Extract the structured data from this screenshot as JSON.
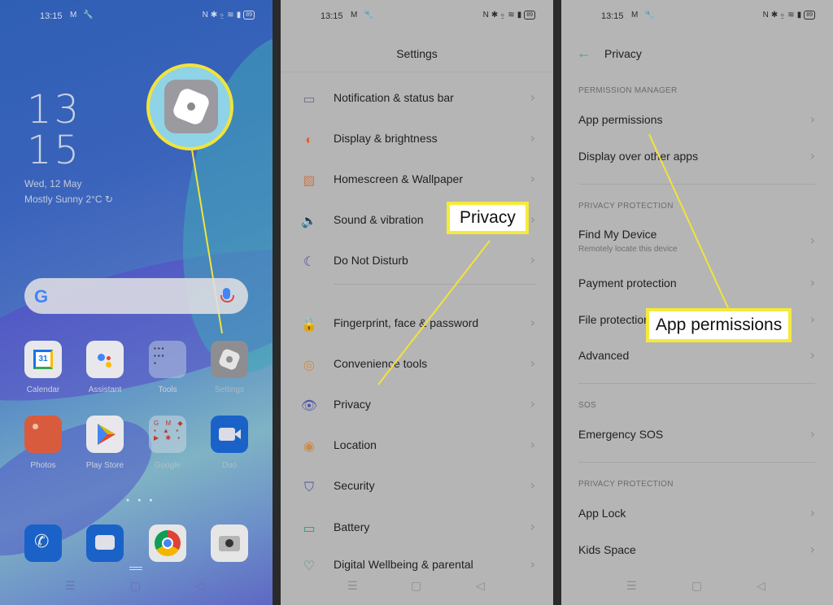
{
  "status_bar": {
    "time": "13:15",
    "left_icons": [
      "gmail-m-icon",
      "wrench-icon"
    ],
    "right_icons": [
      "nfc-icon",
      "bluetooth-icon",
      "vibrate-icon",
      "wifi-icon",
      "signal-icon"
    ],
    "battery": "89"
  },
  "home": {
    "clock_hour": "13",
    "clock_minute": "15",
    "date": "Wed, 12 May",
    "weather": "Mostly Sunny 2°C",
    "search_logo": "G",
    "apps_row1": [
      {
        "label": "Calendar",
        "color": "#e8e8ec"
      },
      {
        "label": "Assistant",
        "color": "#e8e8ec"
      },
      {
        "label": "Tools",
        "color": "#9db0cf"
      },
      {
        "label": "Settings",
        "color": "#8d8d92"
      }
    ],
    "apps_row2": [
      {
        "label": "Photos",
        "color": "#d95b3d"
      },
      {
        "label": "Play Store",
        "color": "#e8e8ec"
      },
      {
        "label": "Google",
        "color": "#a9c6d4"
      },
      {
        "label": "Duo",
        "color": "#1a62c8"
      }
    ],
    "dock": [
      {
        "name": "phone",
        "color": "#1a62c8"
      },
      {
        "name": "messages",
        "color": "#1a62c8"
      },
      {
        "name": "chrome",
        "color": "#e6e6e6"
      },
      {
        "name": "camera",
        "color": "#e6e6e6"
      }
    ],
    "calendar_day": "31"
  },
  "settings": {
    "title": "Settings",
    "items": [
      {
        "label": "Notification & status bar",
        "icon": "notification-icon",
        "glyph": "▭",
        "color": "#6a6f86"
      },
      {
        "label": "Display & brightness",
        "icon": "brightness-icon",
        "glyph": "◐",
        "color": "#d8653a"
      },
      {
        "label": "Homescreen & Wallpaper",
        "icon": "wallpaper-icon",
        "glyph": "▨",
        "color": "#c97a55"
      },
      {
        "label": "Sound & vibration",
        "icon": "speaker-icon",
        "glyph": "🔈",
        "color": "#5a9a5a"
      },
      {
        "label": "Do Not Disturb",
        "icon": "moon-icon",
        "glyph": "☾",
        "color": "#4b4f9a"
      },
      {
        "label": "Fingerprint, face & password",
        "icon": "lock-icon",
        "glyph": "🔒",
        "color": "#5b61a5"
      },
      {
        "label": "Convenience tools",
        "icon": "head-target-icon",
        "glyph": "◎",
        "color": "#d08a45"
      },
      {
        "label": "Privacy",
        "icon": "privacy-eye-icon",
        "glyph": "👁",
        "color": "#4f56a8"
      },
      {
        "label": "Location",
        "icon": "location-pin-icon",
        "glyph": "◉",
        "color": "#c98a4a"
      },
      {
        "label": "Security",
        "icon": "shield-icon",
        "glyph": "⛉",
        "color": "#4f56a8"
      },
      {
        "label": "Battery",
        "icon": "battery-icon",
        "glyph": "▭",
        "color": "#2e9a70"
      },
      {
        "label": "Digital Wellbeing & parental",
        "icon": "wellbeing-icon",
        "glyph": "♡",
        "color": "#4e8a6a"
      }
    ],
    "callout": "Privacy"
  },
  "privacy": {
    "title": "Privacy",
    "sections": [
      {
        "header": "PERMISSION MANAGER"
      },
      {
        "header": "PRIVACY PROTECTION"
      },
      {
        "header": "SOS"
      },
      {
        "header": "PRIVACY PROTECTION"
      }
    ],
    "items": {
      "app_permissions": "App permissions",
      "display_over": "Display over other apps",
      "find_device": "Find My Device",
      "find_device_sub": "Remotely locate this device",
      "payment": "Payment protection",
      "file": "File protection",
      "advanced": "Advanced",
      "emergency": "Emergency SOS",
      "app_lock": "App Lock",
      "kids": "Kids Space"
    },
    "callout": "App permissions"
  },
  "accent": {
    "callout_border": "#f5ea3a",
    "back_arrow": "#3aa383"
  }
}
